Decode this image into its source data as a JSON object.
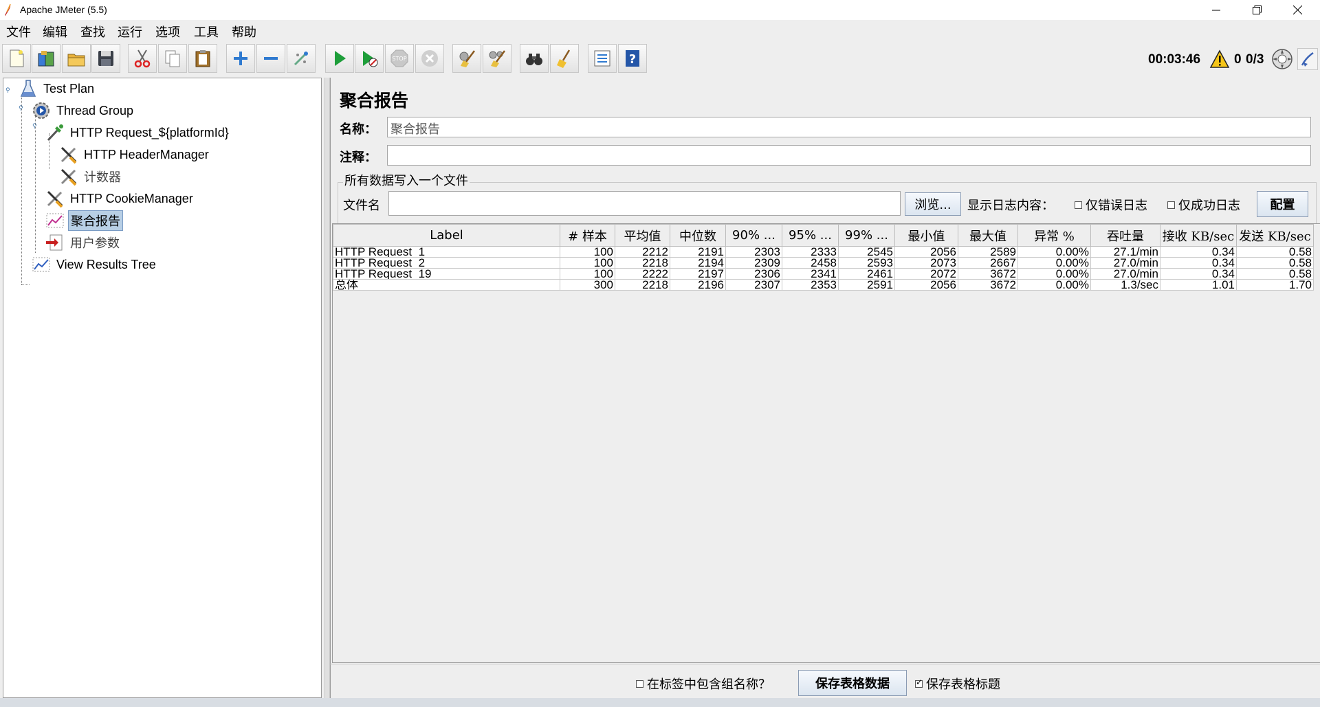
{
  "window": {
    "title": "Apache JMeter (5.5)"
  },
  "menu": [
    "文件",
    "编辑",
    "查找",
    "运行",
    "选项",
    "工具",
    "帮助"
  ],
  "toolbar": {
    "buttons": [
      "new",
      "templates",
      "open",
      "save",
      "cut",
      "copy",
      "paste",
      "expand",
      "collapse",
      "toggle",
      "start",
      "start-no-pauses",
      "stop",
      "shutdown",
      "clear",
      "clear-all",
      "search",
      "reset-search",
      "function-helper",
      "help"
    ],
    "elapsed_time": "00:03:46",
    "warning_count": "0",
    "active_threads": "0/3"
  },
  "tree": {
    "nodes": [
      {
        "label": "Test Plan",
        "icon": "test-plan-icon"
      },
      {
        "label": "Thread Group",
        "icon": "thread-group-icon"
      },
      {
        "label": "HTTP Request_${platformId}",
        "icon": "sampler-icon"
      },
      {
        "label": "HTTP HeaderManager",
        "icon": "config-tool-icon"
      },
      {
        "label": "计数器",
        "icon": "config-tool-icon"
      },
      {
        "label": "HTTP CookieManager",
        "icon": "config-tool-icon"
      },
      {
        "label": "聚合报告",
        "icon": "listener-icon"
      },
      {
        "label": "用户参数",
        "icon": "preprocessor-icon"
      },
      {
        "label": "View Results Tree",
        "icon": "listener-icon"
      }
    ]
  },
  "panel": {
    "title": "聚合报告",
    "name_label": "名称：",
    "name_value": "聚合报告",
    "comment_label": "注释：",
    "comment_value": "",
    "file_group_title": "所有数据写入一个文件",
    "filename_label": "文件名",
    "filename_value": "",
    "browse_label": "浏览...",
    "log_content_label": "显示日志内容：",
    "errors_only_label": "仅错误日志",
    "success_only_label": "仅成功日志",
    "config_label": "配置"
  },
  "table": {
    "headers": [
      "Label",
      "# 样本",
      "平均值",
      "中位数",
      "90% ...",
      "95% ...",
      "99% ...",
      "最小值",
      "最大值",
      "异常 %",
      "吞吐量",
      "接收 KB/sec",
      "发送 KB/sec"
    ],
    "rows": [
      [
        "HTTP Request_1",
        "100",
        "2212",
        "2191",
        "2303",
        "2333",
        "2545",
        "2056",
        "2589",
        "0.00%",
        "27.1/min",
        "0.34",
        "0.58"
      ],
      [
        "HTTP Request_2",
        "100",
        "2218",
        "2194",
        "2309",
        "2458",
        "2593",
        "2073",
        "2667",
        "0.00%",
        "27.0/min",
        "0.34",
        "0.58"
      ],
      [
        "HTTP Request_19",
        "100",
        "2222",
        "2197",
        "2306",
        "2341",
        "2461",
        "2072",
        "3672",
        "0.00%",
        "27.0/min",
        "0.34",
        "0.58"
      ],
      [
        "总体",
        "300",
        "2218",
        "2196",
        "2307",
        "2353",
        "2591",
        "2056",
        "3672",
        "0.00%",
        "1.3/sec",
        "1.01",
        "1.70"
      ]
    ]
  },
  "bottom": {
    "include_group_label": "在标签中包含组名称？",
    "include_group_checked": false,
    "save_table_label": "保存表格数据",
    "save_header_label": "保存表格标题",
    "save_header_checked": true
  }
}
